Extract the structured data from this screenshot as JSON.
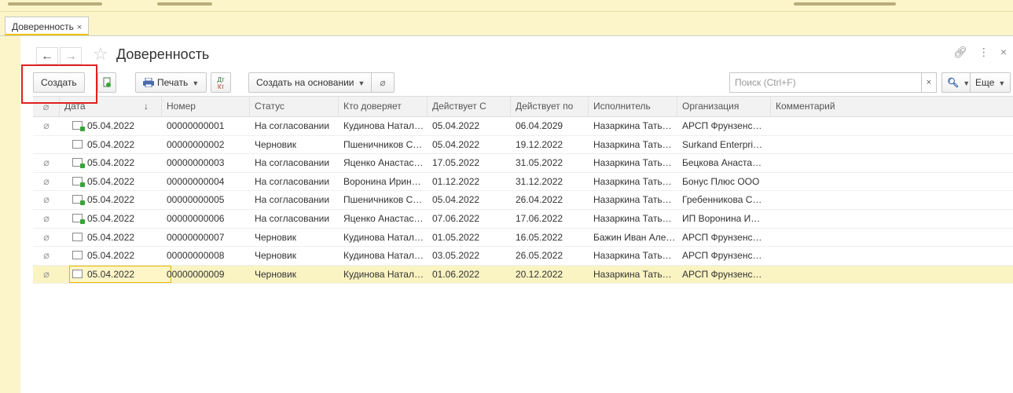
{
  "window": {
    "tab_title": "Доверенность",
    "tab_close": "×",
    "page_title": "Доверенность"
  },
  "toolbar": {
    "create_label": "Создать",
    "print_label": "Печать",
    "dtkt_label_top": "Дт",
    "dtkt_label_bottom": "Кт",
    "create_based_label": "Создать на основании",
    "search_placeholder": "Поиск (Ctrl+F)",
    "search_clear": "×",
    "more_label": "Еще"
  },
  "icons": {
    "back": "arrow-left-icon",
    "forward": "arrow-right-icon",
    "favorite": "star-icon",
    "link": "link-icon",
    "menu": "more-vertical-icon",
    "close": "close-icon",
    "copy": "copy-document-icon",
    "printer": "printer-icon",
    "attachment": "paperclip-icon",
    "search": "search-icon"
  },
  "table": {
    "columns": [
      "Дата",
      "Номер",
      "Статус",
      "Кто доверяет",
      "Действует С",
      "Действует по",
      "Исполнитель",
      "Организация",
      "Комментарий"
    ],
    "sort_indicator": "↓",
    "rows": [
      {
        "clip": true,
        "posted": true,
        "date": "05.04.2022",
        "number": "00000000001",
        "status": "На согласовании",
        "trustor": "Кудинова Натал…",
        "from": "05.04.2022",
        "to": "06.04.2029",
        "executor": "Назаркина Тать…",
        "org": "АРСП Фрунзенс…",
        "comment": ""
      },
      {
        "clip": false,
        "posted": false,
        "date": "05.04.2022",
        "number": "00000000002",
        "status": "Черновик",
        "trustor": "Пшеничников С…",
        "from": "05.04.2022",
        "to": "19.12.2022",
        "executor": "Назаркина Тать…",
        "org": "Surkand Enterpri…",
        "comment": ""
      },
      {
        "clip": true,
        "posted": true,
        "date": "05.04.2022",
        "number": "00000000003",
        "status": "На согласовании",
        "trustor": "Яценко Анастас…",
        "from": "17.05.2022",
        "to": "31.05.2022",
        "executor": "Назаркина Тать…",
        "org": "Бецкова Анаста…",
        "comment": ""
      },
      {
        "clip": true,
        "posted": true,
        "date": "05.04.2022",
        "number": "00000000004",
        "status": "На согласовании",
        "trustor": "Воронина Ирин…",
        "from": "01.12.2022",
        "to": "31.12.2022",
        "executor": "Назаркина Тать…",
        "org": "Бонус Плюс ООО",
        "comment": ""
      },
      {
        "clip": true,
        "posted": true,
        "date": "05.04.2022",
        "number": "00000000005",
        "status": "На согласовании",
        "trustor": "Пшеничников С…",
        "from": "05.04.2022",
        "to": "26.04.2022",
        "executor": "Назаркина Тать…",
        "org": "Гребенникова С…",
        "comment": ""
      },
      {
        "clip": true,
        "posted": true,
        "date": "05.04.2022",
        "number": "00000000006",
        "status": "На согласовании",
        "trustor": "Яценко Анастас…",
        "from": "07.06.2022",
        "to": "17.06.2022",
        "executor": "Назаркина Тать…",
        "org": "ИП Воронина И…",
        "comment": ""
      },
      {
        "clip": true,
        "posted": false,
        "date": "05.04.2022",
        "number": "00000000007",
        "status": "Черновик",
        "trustor": "Кудинова Натал…",
        "from": "01.05.2022",
        "to": "16.05.2022",
        "executor": "Бажин Иван Але…",
        "org": "АРСП Фрунзенс…",
        "comment": ""
      },
      {
        "clip": true,
        "posted": false,
        "date": "05.04.2022",
        "number": "00000000008",
        "status": "Черновик",
        "trustor": "Кудинова Натал…",
        "from": "03.05.2022",
        "to": "26.05.2022",
        "executor": "Назаркина Тать…",
        "org": "АРСП Фрунзенс…",
        "comment": ""
      },
      {
        "clip": true,
        "posted": false,
        "date": "05.04.2022",
        "number": "00000000009",
        "status": "Черновик",
        "trustor": "Кудинова Натал…",
        "from": "01.06.2022",
        "to": "20.12.2022",
        "executor": "Назаркина Тать…",
        "org": "АРСП Фрунзенс…",
        "comment": "",
        "selected": true
      }
    ]
  },
  "colors": {
    "accent_yellow": "#fbf5c9",
    "selected_row": "#faf3c2",
    "highlight_red": "#e02020",
    "posted_green": "#3aa33a"
  }
}
